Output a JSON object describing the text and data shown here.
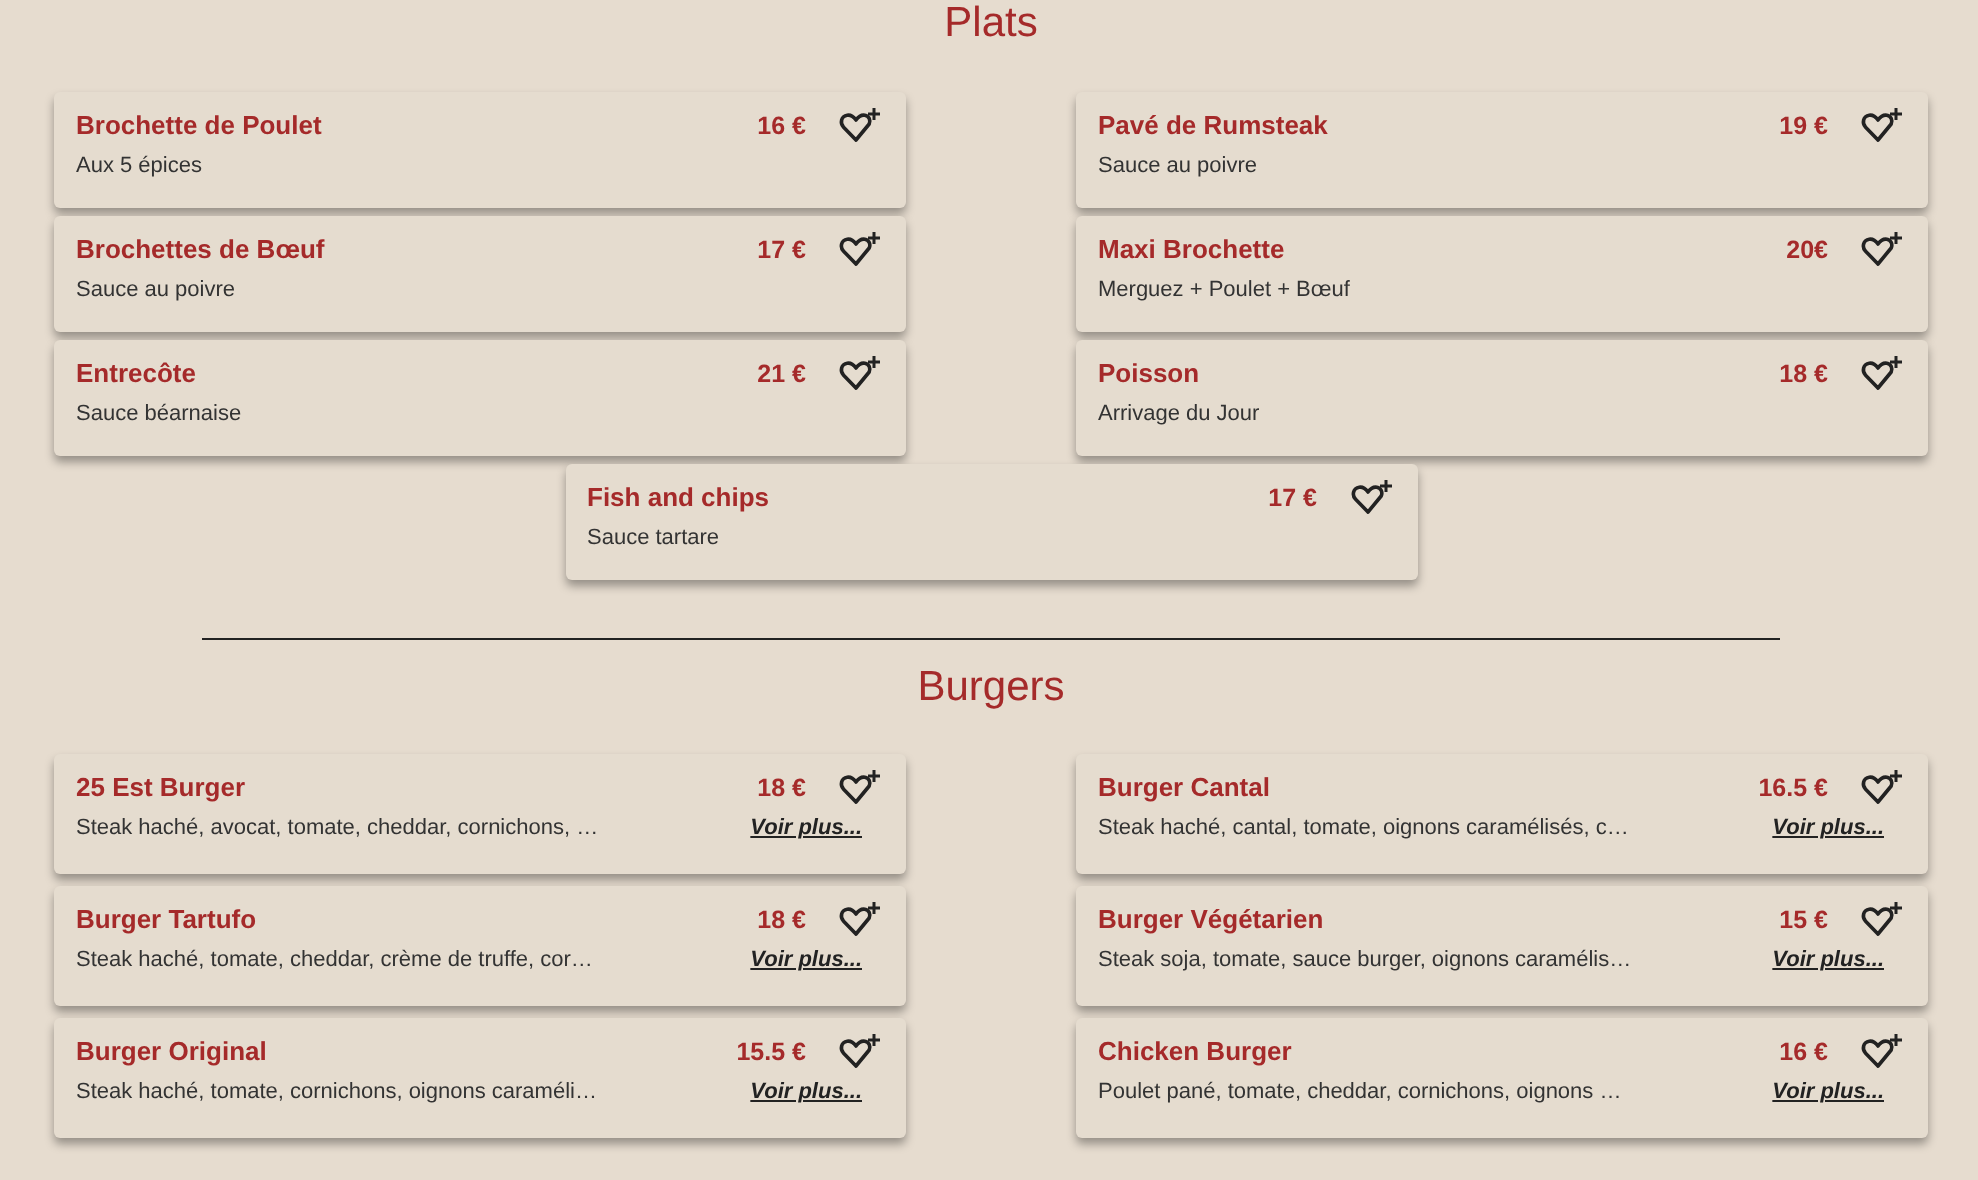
{
  "sections": [
    {
      "title": "Plats",
      "items": [
        {
          "name": "Brochette de Poulet",
          "price": "16 €",
          "description": "Aux 5 épices"
        },
        {
          "name": "Pavé de Rumsteak",
          "price": "19 €",
          "description": "Sauce au poivre"
        },
        {
          "name": "Brochettes de Bœuf",
          "price": "17 €",
          "description": "Sauce au poivre"
        },
        {
          "name": "Maxi Brochette",
          "price": "20€",
          "description": "Merguez + Poulet + Bœuf"
        },
        {
          "name": "Entrecôte",
          "price": "21 €",
          "description": "Sauce béarnaise"
        },
        {
          "name": "Poisson",
          "price": "18 €",
          "description": "Arrivage du Jour"
        },
        {
          "name": "Fish and chips",
          "price": "17 €",
          "description": "Sauce tartare"
        }
      ]
    },
    {
      "title": "Burgers",
      "items": [
        {
          "name": "25 Est Burger",
          "price": "18 €",
          "description": "Steak haché, avocat, tomate, cheddar, cornichons, …",
          "more_link": "Voir plus..."
        },
        {
          "name": "Burger Cantal",
          "price": "16.5 €",
          "description": "Steak haché, cantal, tomate, oignons caramélisés, c…",
          "more_link": "Voir plus..."
        },
        {
          "name": "Burger Tartufo",
          "price": "18 €",
          "description": "Steak haché, tomate, cheddar, crème de truffe, cor…",
          "more_link": "Voir plus..."
        },
        {
          "name": "Burger Végétarien",
          "price": "15 €",
          "description": "Steak soja, tomate, sauce burger, oignons caramélis…",
          "more_link": "Voir plus..."
        },
        {
          "name": "Burger Original",
          "price": "15.5 €",
          "description": "Steak haché, tomate, cornichons, oignons caraméli…",
          "more_link": "Voir plus..."
        },
        {
          "name": "Chicken Burger",
          "price": "16 €",
          "description": "Poulet pané, tomate, cheddar, cornichons, oignons …",
          "more_link": "Voir plus..."
        }
      ]
    }
  ]
}
